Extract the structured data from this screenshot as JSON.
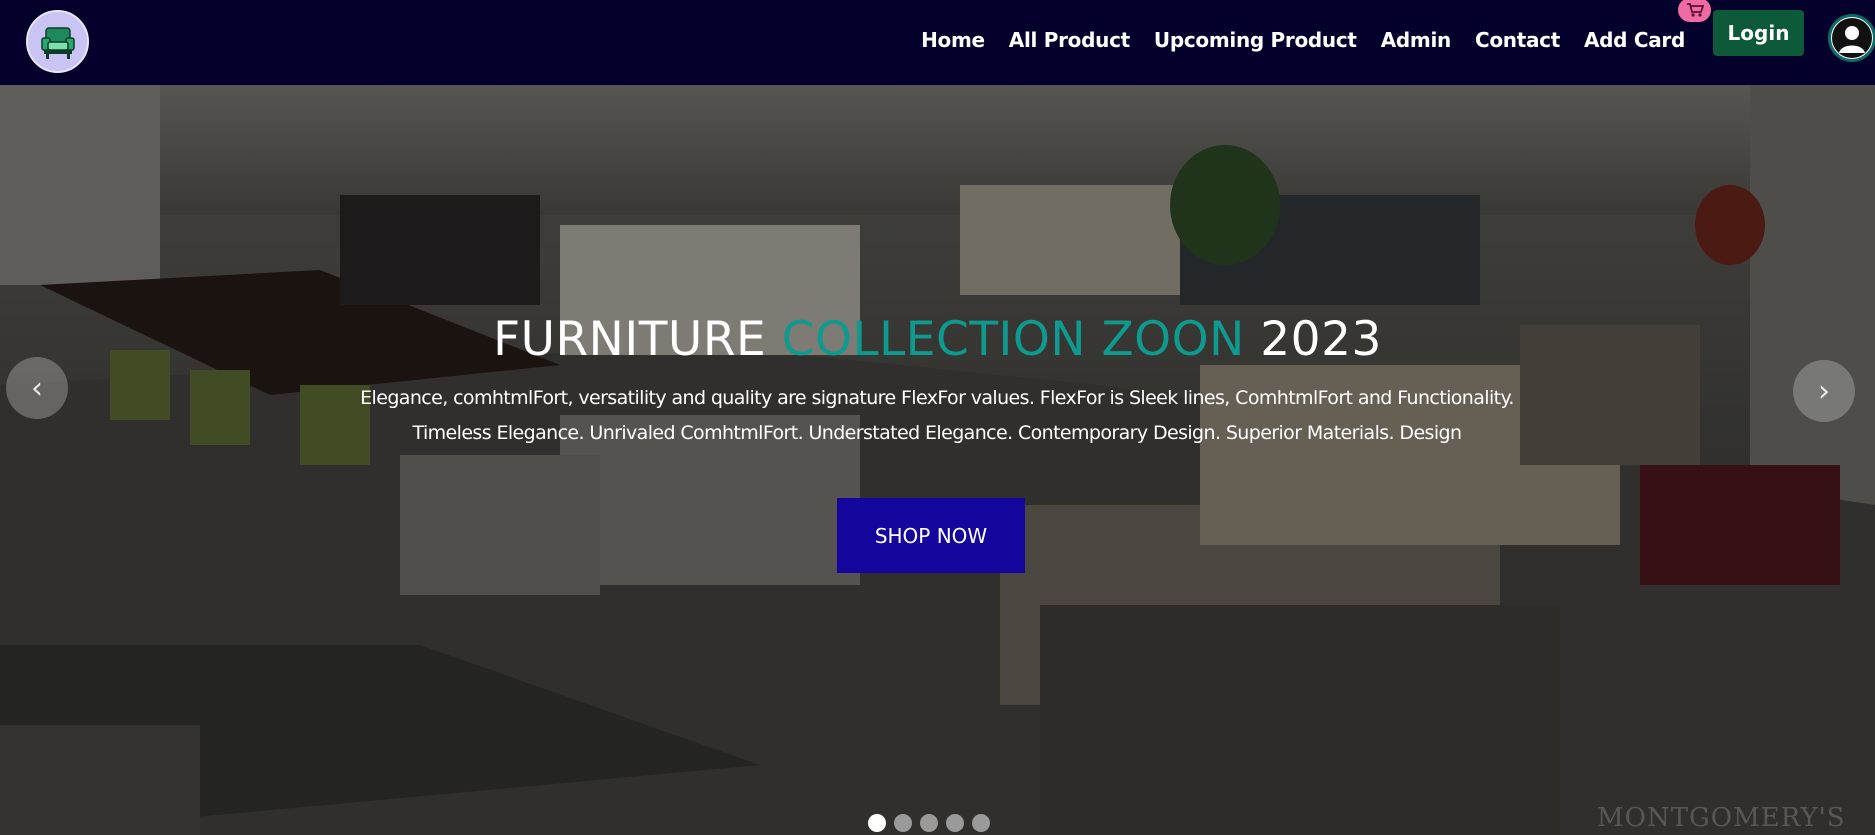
{
  "nav": {
    "logo_icon": "armchair-logo-icon",
    "links": [
      {
        "label": "Home"
      },
      {
        "label": "All Product"
      },
      {
        "label": "Upcoming Product"
      },
      {
        "label": "Admin"
      },
      {
        "label": "Contact"
      },
      {
        "label": "Add Card"
      }
    ],
    "cart_icon": "cart-icon",
    "login_label": "Login",
    "avatar_icon": "user-avatar-icon"
  },
  "hero": {
    "title_part1": "FURNITURE",
    "title_accent": "COLLECTION ZOON",
    "title_part2": "2023",
    "description_line1": "Elegance, comhtmlFort, versatility and quality are signature FlexFor values. FlexFor is Sleek lines, ComhtmlFort and Functionality.",
    "description_line2": "Timeless Elegance. Unrivaled ComhtmlFort. Understated Elegance. Contemporary Design. Superior Materials. Design",
    "cta_label": "SHOP NOW",
    "prev_icon": "chevron-left-icon",
    "next_icon": "chevron-right-icon",
    "prev_glyph": "‹",
    "next_glyph": "›",
    "slide_count": 5,
    "active_slide": 1,
    "watermark": "MONTGOMERY'S"
  },
  "colors": {
    "navbar_bg": "#03012b",
    "accent_teal": "#0e9a8e",
    "cta_bg": "#14069c",
    "login_bg": "#0c5a3a",
    "cart_badge": "#f06ba4"
  }
}
